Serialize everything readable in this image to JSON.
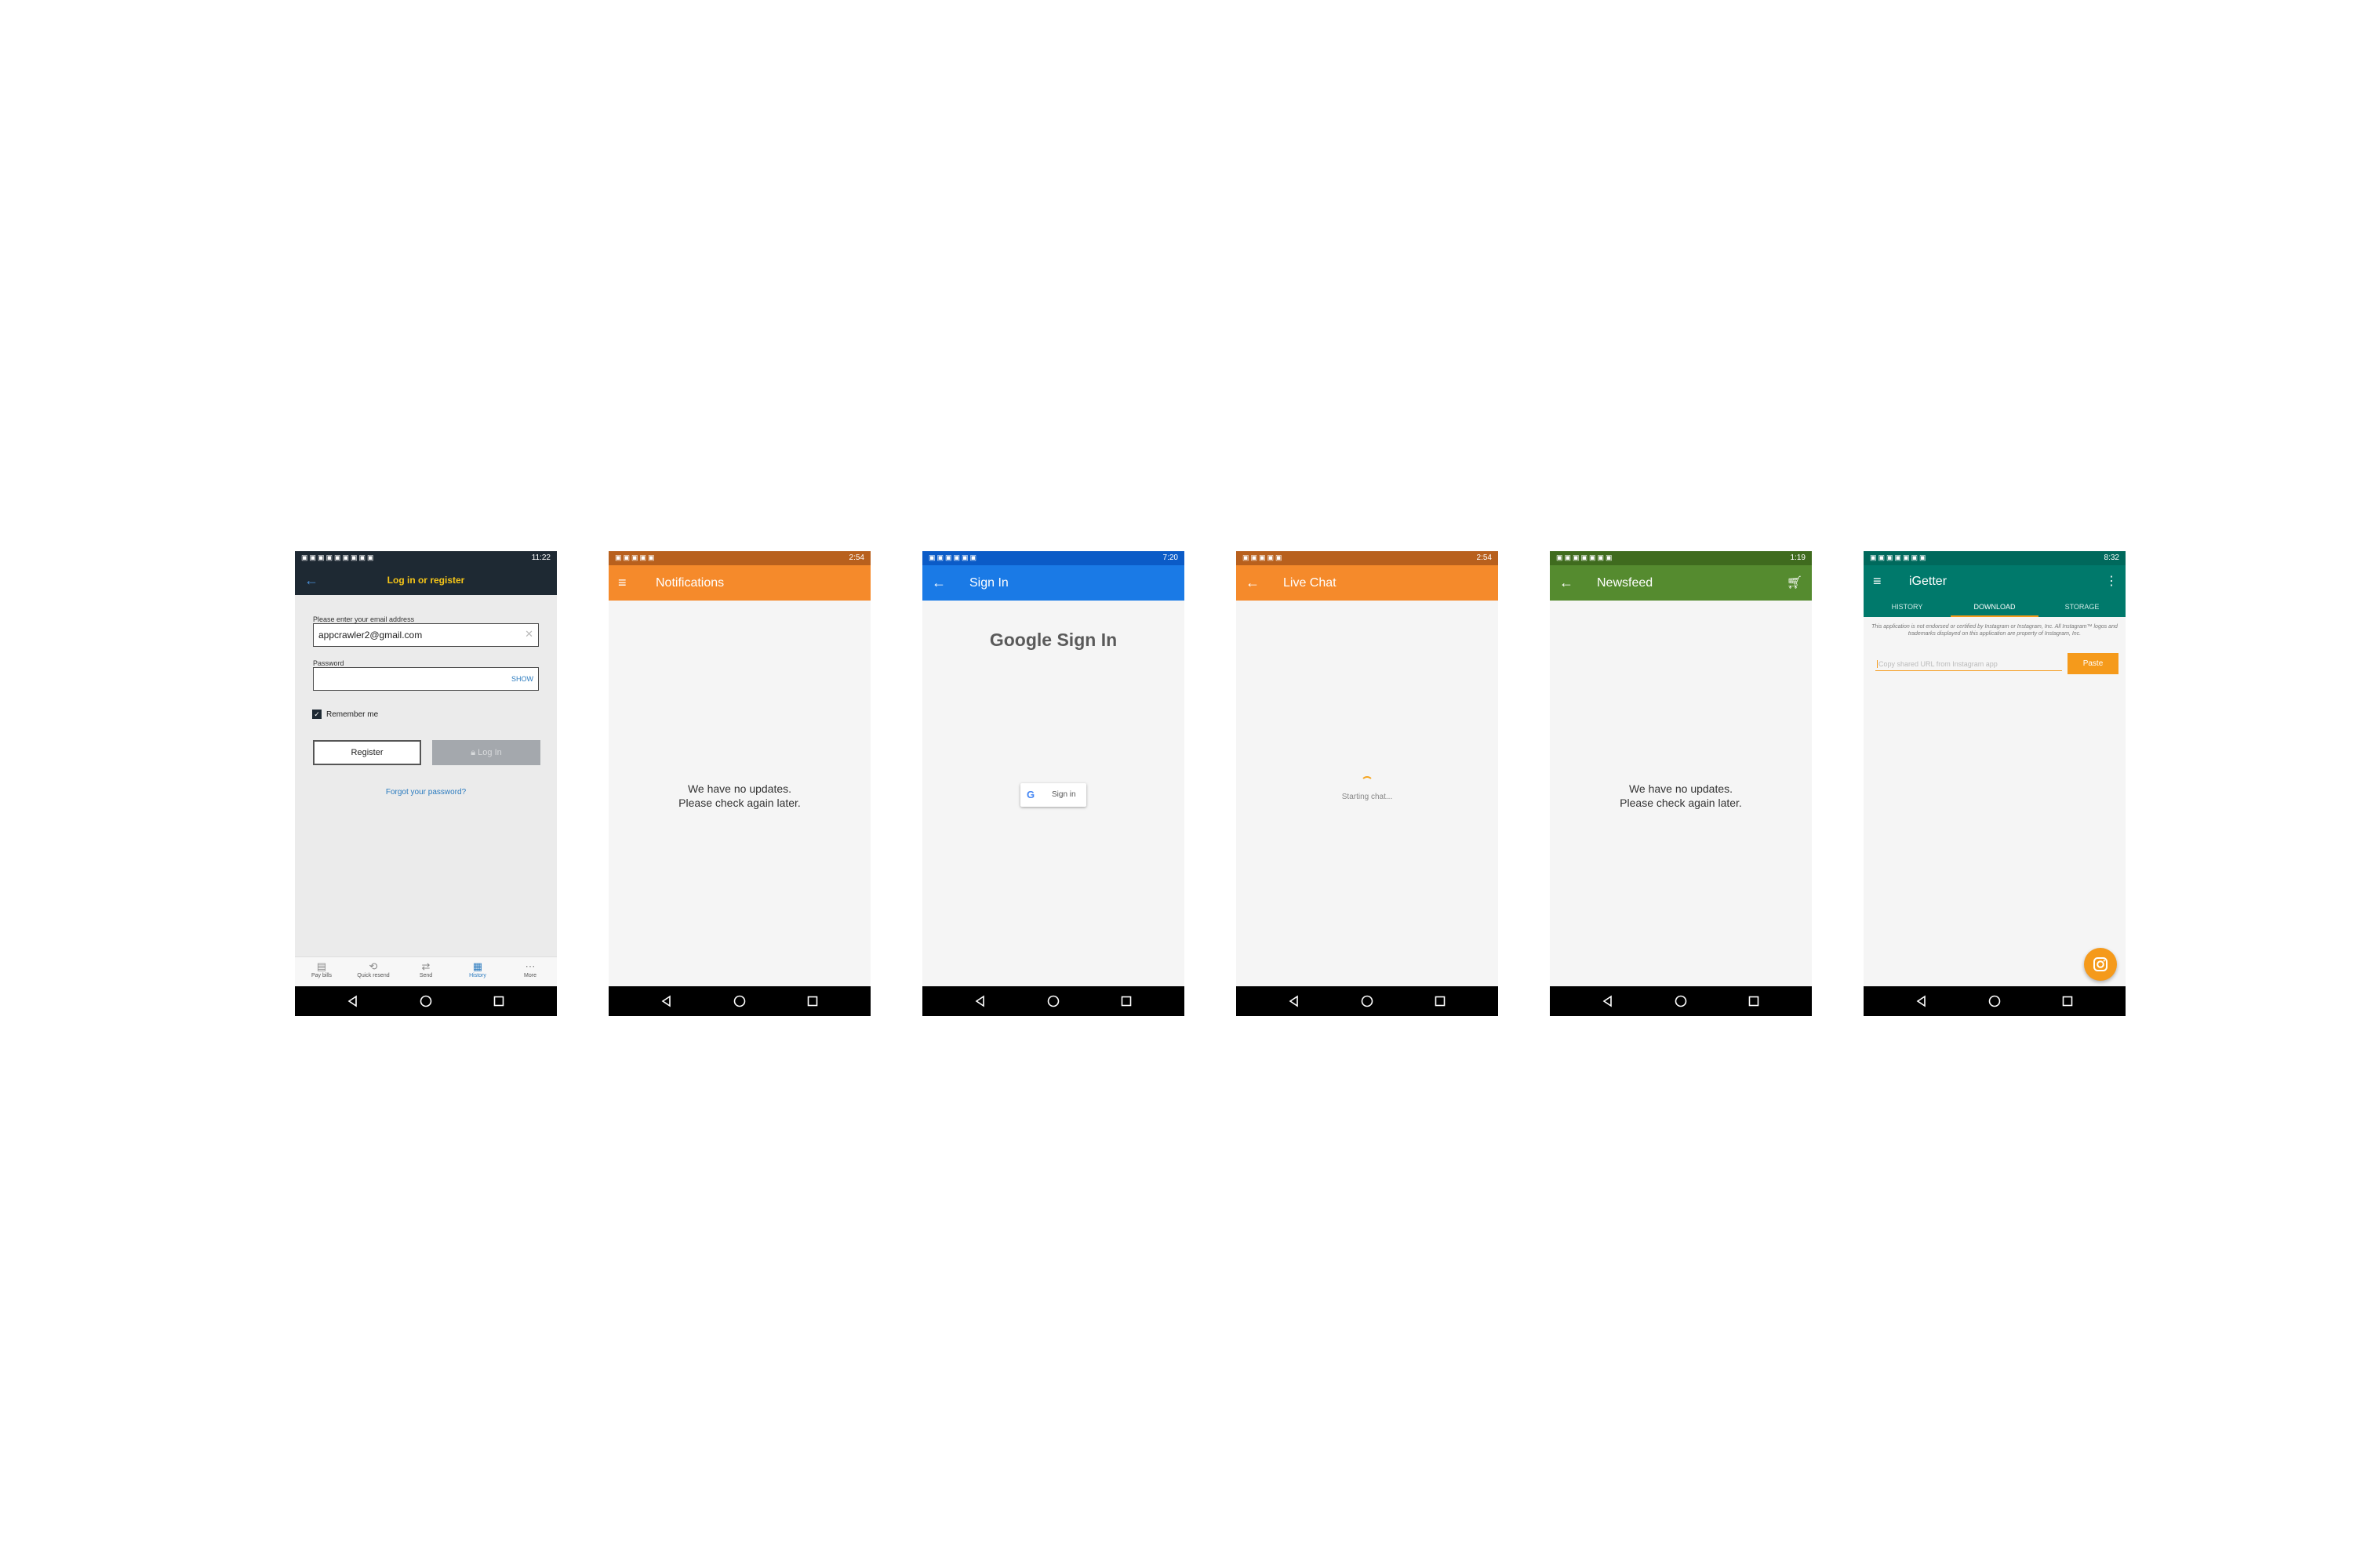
{
  "screens": [
    {
      "id": "login",
      "status_time": "11:22",
      "title": "Log in or register",
      "email_label": "Please enter your email address",
      "email_value": "appcrawler2@gmail.com",
      "password_label": "Password",
      "show_label": "SHOW",
      "remember_label": "Remember me",
      "register_label": "Register",
      "login_label": "Log In",
      "forgot_label": "Forgot your password?",
      "bottom_tabs": [
        {
          "label": "Pay bills",
          "icon": "bills-icon"
        },
        {
          "label": "Quick resend",
          "icon": "resend-icon"
        },
        {
          "label": "Send",
          "icon": "send-icon"
        },
        {
          "label": "History",
          "icon": "history-icon"
        },
        {
          "label": "More",
          "icon": "more-icon"
        }
      ],
      "colors": {
        "bar": "#1e2933",
        "title": "#f5c518",
        "bg": "#ebebeb",
        "accent": "#2b7bbf"
      }
    },
    {
      "id": "notifications",
      "status_time": "2:54",
      "title": "Notifications",
      "message_line1": "We have no updates.",
      "message_line2": "Please check again later.",
      "colors": {
        "status": "#b8601d",
        "bar": "#f58a2b"
      }
    },
    {
      "id": "signin",
      "status_time": "7:20",
      "title": "Sign In",
      "heading": "Google Sign In",
      "button_label": "Sign in",
      "colors": {
        "status": "#0b5bc7",
        "bar": "#1a7ae6"
      }
    },
    {
      "id": "livechat",
      "status_time": "2:54",
      "title": "Live Chat",
      "loading_text": "Starting chat...",
      "colors": {
        "status": "#b8601d",
        "bar": "#f58a2b"
      }
    },
    {
      "id": "newsfeed",
      "status_time": "1:19",
      "title": "Newsfeed",
      "message_line1": "We have no updates.",
      "message_line2": "Please check again later.",
      "colors": {
        "status": "#3f6b1e",
        "bar": "#558b2f"
      }
    },
    {
      "id": "igetter",
      "status_time": "8:32",
      "title": "iGetter",
      "tabs": [
        "HISTORY",
        "DOWNLOAD",
        "STORAGE"
      ],
      "disclaimer": "This application is not endorsed or certified by Instagram or Instagram, Inc. All Instagram™ logos and trademarks displayed on this application are property of Instagram, Inc.",
      "url_placeholder": "Copy shared URL from Instagram app",
      "paste_label": "Paste",
      "colors": {
        "status": "#00695c",
        "bar": "#00796b",
        "accent": "#f59a1b"
      }
    }
  ]
}
